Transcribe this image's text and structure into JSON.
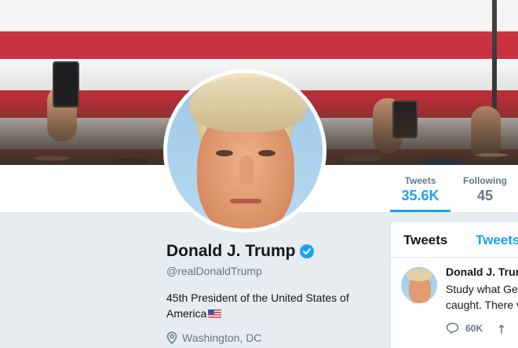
{
  "nav": {
    "tweets": {
      "label": "Tweets",
      "value": "35.6K"
    },
    "following": {
      "label": "Following",
      "value": "45"
    }
  },
  "profile": {
    "name": "Donald J. Trump",
    "handle": "@realDonaldTrump",
    "bio": "45th President of the United States of America",
    "location": "Washington, DC"
  },
  "timeline": {
    "tabs": [
      "Tweets",
      "Tweets"
    ],
    "tweet": {
      "author": "Donald J. Trum",
      "text_line1": "Study what Ger",
      "text_line2": "caught. There v",
      "reply_count": "60K"
    }
  },
  "colors": {
    "accent": "#1da1f2",
    "verified": "#1da1f2"
  },
  "icons": {
    "verified": "verified-badge-icon",
    "location": "map-pin-icon",
    "reply": "reply-icon",
    "retweet": "retweet-icon",
    "flag": "us-flag-icon"
  }
}
